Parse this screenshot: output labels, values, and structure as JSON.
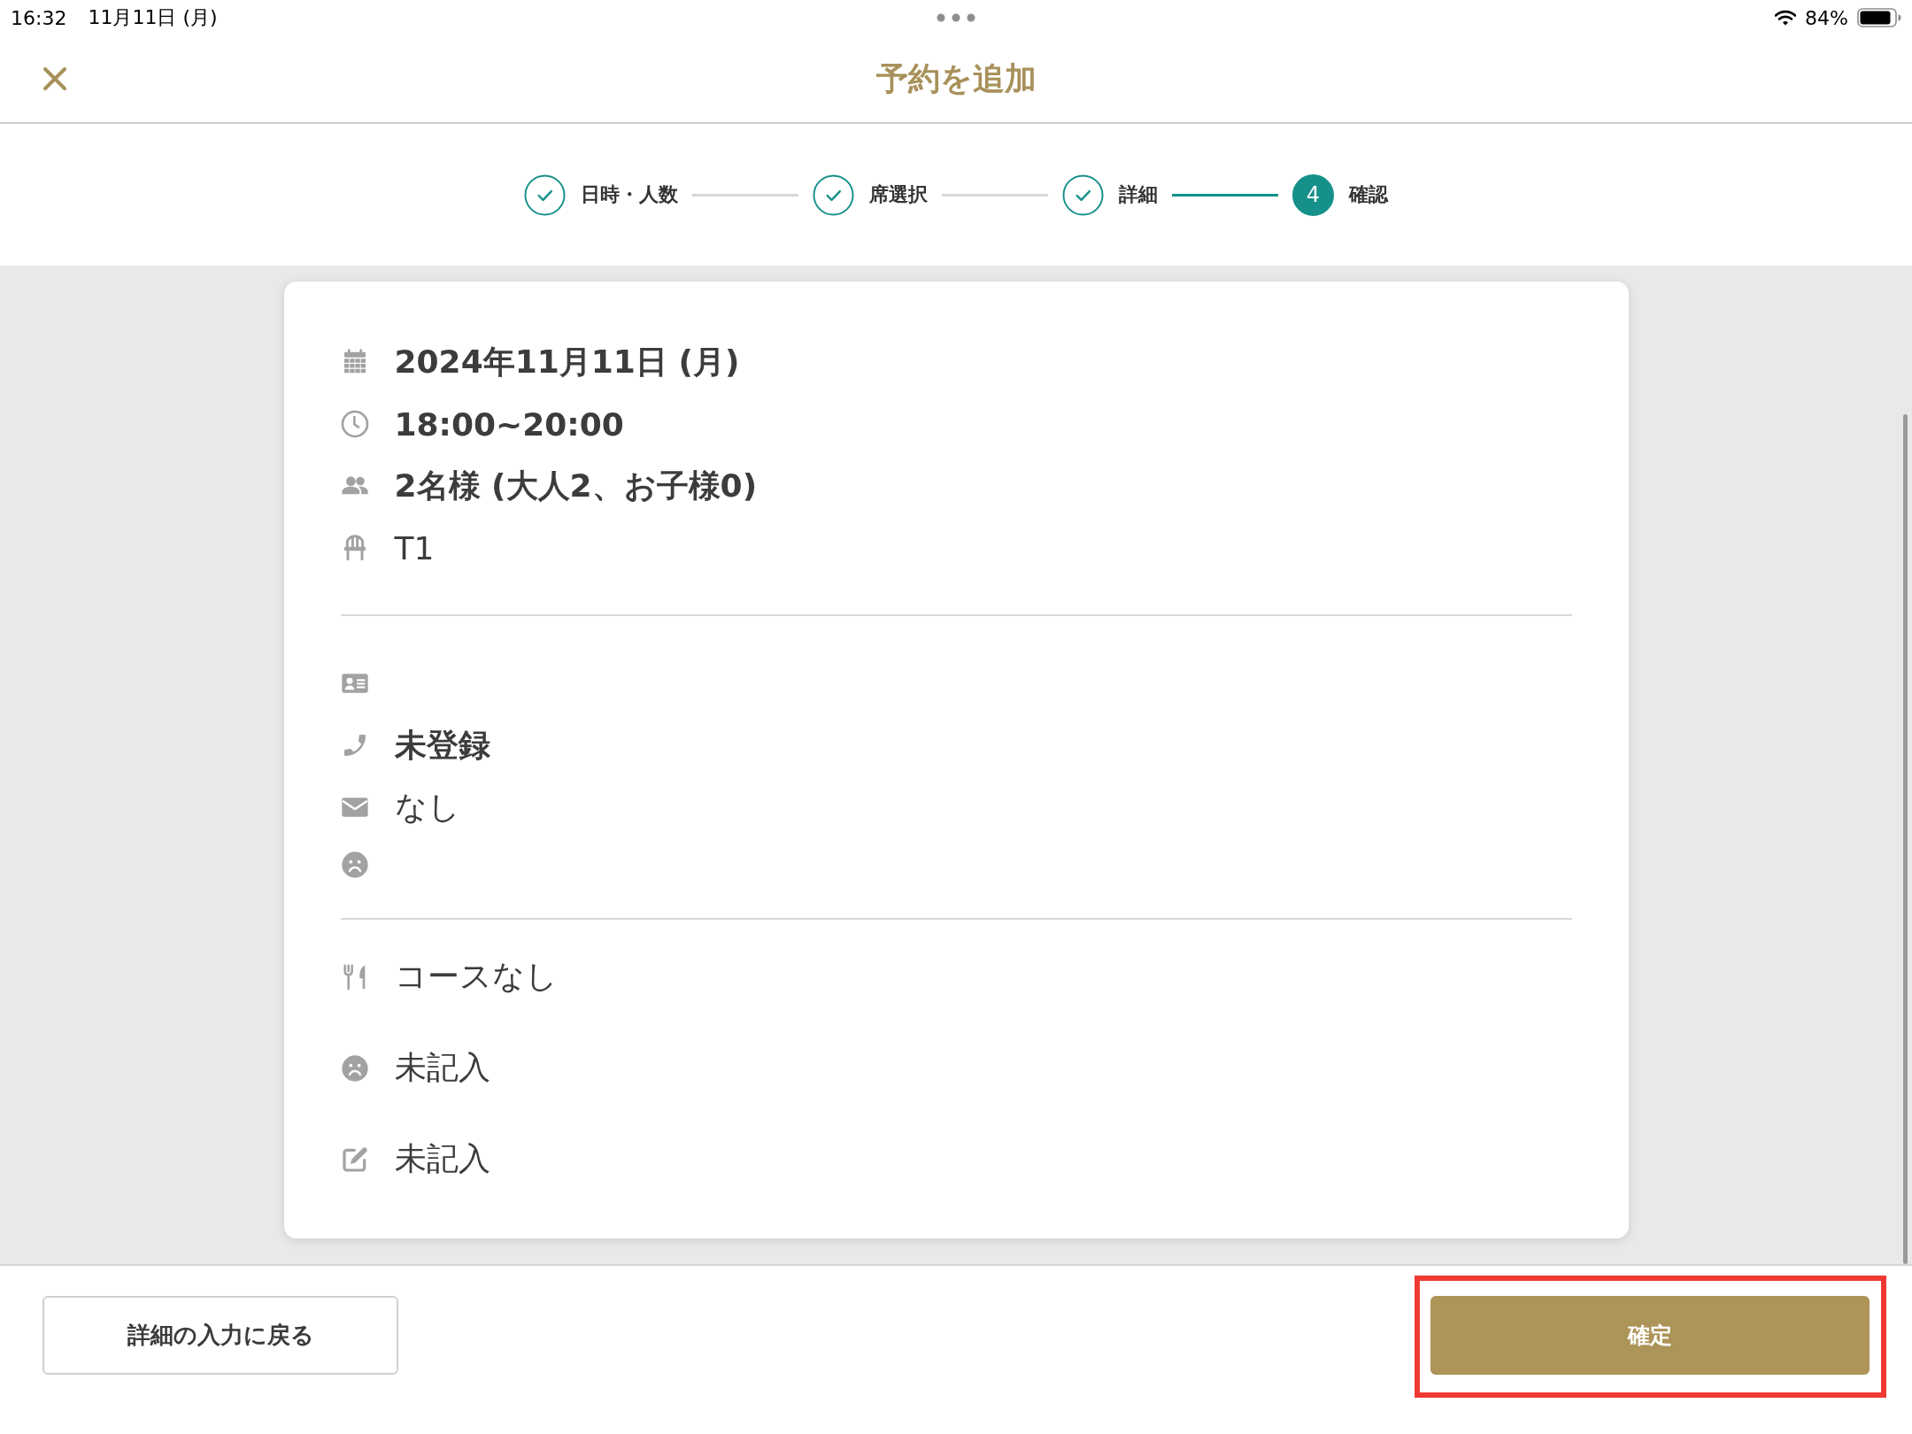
{
  "status_bar": {
    "time": "16:32",
    "date": "11月11日 (月)",
    "battery": "84%"
  },
  "header": {
    "title": "予約を追加"
  },
  "stepper": {
    "steps": [
      {
        "label": "日時・人数",
        "completed": true,
        "selected": false
      },
      {
        "label": "席選択",
        "completed": true,
        "selected": false
      },
      {
        "label": "詳細",
        "completed": true,
        "selected": false
      },
      {
        "label": "確認",
        "number": "4",
        "completed": false,
        "selected": true
      }
    ]
  },
  "summary": {
    "sections": [
      {
        "items": [
          {
            "kind": "date",
            "text": "2024年11月11日 (月)",
            "bold": true
          },
          {
            "kind": "time",
            "text": "18:00~20:00",
            "bold": true
          },
          {
            "kind": "party",
            "text": "2名様 (大人2、お子様0)",
            "bold": true
          },
          {
            "kind": "seat",
            "text": "T1",
            "bold": false
          }
        ]
      },
      {
        "items": [
          {
            "kind": "contact"
          },
          {
            "kind": "phone",
            "text": "未登録",
            "bold": true
          },
          {
            "kind": "email",
            "text": "なし",
            "bold": false
          },
          {
            "kind": "mood"
          }
        ]
      },
      {
        "items": [
          {
            "kind": "course",
            "text": "コースなし",
            "bold": false
          },
          {
            "kind": "mood",
            "text": "未記入",
            "bold": false
          },
          {
            "kind": "note",
            "text": "未記入",
            "bold": false
          }
        ]
      }
    ]
  },
  "footer": {
    "buttons": [
      {
        "label": "詳細の入力に戻る",
        "kind": "secondary",
        "highlighted": false
      },
      {
        "label": "確定",
        "kind": "primary",
        "highlighted": true
      }
    ]
  }
}
